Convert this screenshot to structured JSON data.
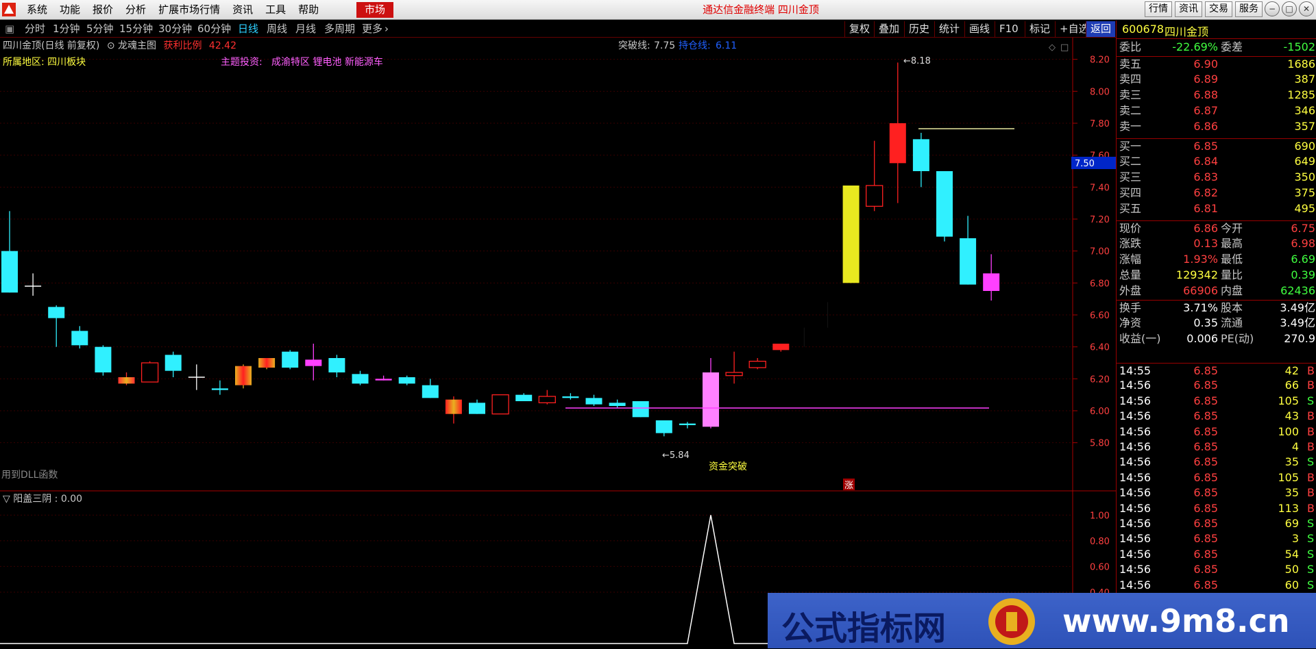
{
  "menu": [
    "系统",
    "功能",
    "报价",
    "分析",
    "扩展市场行情",
    "资讯",
    "工具",
    "帮助"
  ],
  "market_btn": "市场",
  "app_title": "通达信金融终端  四川金顶",
  "win_buttons": [
    "行情",
    "资讯",
    "交易",
    "服务"
  ],
  "timeframes": [
    "分时",
    "1分钟",
    "5分钟",
    "15分钟",
    "30分钟",
    "60分钟",
    "日线",
    "周线",
    "月线",
    "多周期",
    "更多"
  ],
  "active_timeframe": "日线",
  "right_tools": [
    "复权",
    "叠加",
    "历史",
    "统计",
    "画线",
    "F10",
    "标记",
    "+自选",
    "返回"
  ],
  "info": {
    "stock": "四川金顶(日线 前复权)",
    "indicator_name": "龙魂主图",
    "profit_label": "获利比例",
    "profit_value": "42.42",
    "breakout_label": "突破线:",
    "breakout_value": "7.75",
    "hold_label": "持仓线:",
    "hold_value": "6.11",
    "region_label": "所属地区:",
    "region_value": "四川板块",
    "theme_label": "主题投资:",
    "theme_value": "成渝特区 锂电池 新能源车",
    "dll_note": "用到DLL函数",
    "fund_break": "资金突破",
    "high_label": "8.18",
    "low_label": "5.84",
    "zhang": "涨"
  },
  "sub_indicator": {
    "name": "阳盖三阴",
    "value": "0.00"
  },
  "price_axis": [
    "8.20",
    "8.00",
    "7.80",
    "7.60",
    "7.40",
    "7.20",
    "7.00",
    "6.80",
    "6.60",
    "6.40",
    "6.20",
    "6.00",
    "5.80"
  ],
  "cursor_price": "7.50",
  "sub_axis": [
    "1.00",
    "0.80",
    "0.60",
    "0.40"
  ],
  "chart_data": {
    "type": "candlestick",
    "ylim": [
      5.7,
      8.25
    ],
    "ohlc": [
      [
        7.0,
        7.25,
        6.74,
        6.74,
        "cyan"
      ],
      [
        6.78,
        6.86,
        6.72,
        6.78,
        "cross"
      ],
      [
        6.65,
        6.66,
        6.4,
        6.58,
        "cyan"
      ],
      [
        6.5,
        6.53,
        6.39,
        6.41,
        "cyan"
      ],
      [
        6.4,
        6.41,
        6.22,
        6.24,
        "cyan"
      ],
      [
        6.17,
        6.24,
        6.16,
        6.21,
        "gold"
      ],
      [
        6.18,
        6.31,
        6.18,
        6.3,
        "hollow"
      ],
      [
        6.35,
        6.37,
        6.21,
        6.25,
        "cyan"
      ],
      [
        6.21,
        6.29,
        6.13,
        6.21,
        "cross"
      ],
      [
        6.14,
        6.19,
        6.1,
        6.13,
        "cyan"
      ],
      [
        6.16,
        6.29,
        6.14,
        6.28,
        "red-gold"
      ],
      [
        6.27,
        6.33,
        6.26,
        6.33,
        "red-gold"
      ],
      [
        6.37,
        6.38,
        6.26,
        6.27,
        "cyan"
      ],
      [
        6.28,
        6.42,
        6.19,
        6.32,
        "magenta"
      ],
      [
        6.33,
        6.35,
        6.21,
        6.24,
        "cyan"
      ],
      [
        6.23,
        6.25,
        6.16,
        6.17,
        "cyan"
      ],
      [
        6.2,
        6.22,
        6.19,
        6.19,
        "magenta"
      ],
      [
        6.21,
        6.22,
        6.16,
        6.17,
        "cyan"
      ],
      [
        6.16,
        6.2,
        6.08,
        6.08,
        "cyan"
      ],
      [
        5.98,
        6.09,
        5.92,
        6.07,
        "gold-red"
      ],
      [
        6.05,
        6.07,
        5.98,
        5.98,
        "cyan"
      ],
      [
        5.98,
        6.1,
        5.98,
        6.1,
        "hollow"
      ],
      [
        6.1,
        6.11,
        6.07,
        6.06,
        "cyan"
      ],
      [
        6.05,
        6.13,
        6.04,
        6.09,
        "hollow"
      ],
      [
        6.09,
        6.11,
        6.07,
        6.08,
        "cyan"
      ],
      [
        6.08,
        6.1,
        6.03,
        6.04,
        "cyan"
      ],
      [
        6.05,
        6.07,
        6.02,
        6.03,
        "cyan"
      ],
      [
        6.06,
        6.06,
        5.96,
        5.96,
        "cyan"
      ],
      [
        5.94,
        5.94,
        5.84,
        5.86,
        "cyan"
      ],
      [
        5.92,
        5.93,
        5.89,
        5.91,
        "cyan"
      ],
      [
        5.9,
        6.33,
        5.89,
        6.24,
        "pink"
      ],
      [
        6.22,
        6.37,
        6.17,
        6.24,
        "hollow"
      ],
      [
        6.27,
        6.33,
        6.26,
        6.31,
        "hollow"
      ],
      [
        6.38,
        6.42,
        6.37,
        6.42,
        "red"
      ],
      [
        6.42,
        6.52,
        6.4,
        6.52,
        "black"
      ],
      [
        6.55,
        6.68,
        6.52,
        6.65,
        "black"
      ],
      [
        6.8,
        7.41,
        6.8,
        7.41,
        "yellow"
      ],
      [
        7.28,
        7.69,
        7.25,
        7.41,
        "hollow"
      ],
      [
        7.55,
        8.18,
        7.3,
        7.8,
        "red"
      ],
      [
        7.7,
        7.74,
        7.4,
        7.5,
        "cyan"
      ],
      [
        7.5,
        7.5,
        7.06,
        7.09,
        "cyan"
      ],
      [
        7.08,
        7.22,
        6.79,
        6.79,
        "cyan"
      ],
      [
        6.86,
        6.98,
        6.69,
        6.75,
        "magenta"
      ]
    ],
    "sub_series": [
      0,
      0,
      0,
      0,
      0,
      0,
      0,
      0,
      0,
      0,
      0,
      0,
      0,
      0,
      0,
      0,
      0,
      0,
      0,
      0,
      0,
      0,
      0,
      0,
      0,
      0,
      0,
      0,
      0,
      0,
      1,
      0,
      0,
      0,
      0,
      0,
      0,
      0,
      0,
      0,
      0,
      0,
      0
    ]
  },
  "quote": {
    "code": "600678",
    "name": "四川金顶",
    "wb_label": "委比",
    "wb": "-22.69%",
    "wc_label": "委差",
    "wc": "-1502",
    "asks": [
      [
        "卖五",
        "6.90",
        "1686"
      ],
      [
        "卖四",
        "6.89",
        "387"
      ],
      [
        "卖三",
        "6.88",
        "1285"
      ],
      [
        "卖二",
        "6.87",
        "346"
      ],
      [
        "卖一",
        "6.86",
        "357"
      ]
    ],
    "bids": [
      [
        "买一",
        "6.85",
        "690"
      ],
      [
        "买二",
        "6.84",
        "649"
      ],
      [
        "买三",
        "6.83",
        "350"
      ],
      [
        "买四",
        "6.82",
        "375"
      ],
      [
        "买五",
        "6.81",
        "495"
      ]
    ],
    "stats": [
      [
        "现价",
        "6.86",
        "今开",
        "6.75"
      ],
      [
        "涨跌",
        "0.13",
        "最高",
        "6.98"
      ],
      [
        "涨幅",
        "1.93%",
        "最低",
        "6.69"
      ],
      [
        "总量",
        "129342",
        "量比",
        "0.39"
      ],
      [
        "外盘",
        "66906",
        "内盘",
        "62436"
      ]
    ],
    "fin": [
      [
        "换手",
        "3.71%",
        "股本",
        "3.49亿"
      ],
      [
        "净资",
        "0.35",
        "流通",
        "3.49亿"
      ],
      [
        "收益(一)",
        "0.006",
        "PE(动)",
        "270.9"
      ]
    ],
    "ticks": [
      [
        "14:55",
        "6.85",
        "42",
        "B"
      ],
      [
        "14:56",
        "6.85",
        "66",
        "B"
      ],
      [
        "14:56",
        "6.85",
        "105",
        "S"
      ],
      [
        "14:56",
        "6.85",
        "43",
        "B"
      ],
      [
        "14:56",
        "6.85",
        "100",
        "B"
      ],
      [
        "14:56",
        "6.85",
        "4",
        "B"
      ],
      [
        "14:56",
        "6.85",
        "35",
        "S"
      ],
      [
        "14:56",
        "6.85",
        "105",
        "B"
      ],
      [
        "14:56",
        "6.85",
        "35",
        "B"
      ],
      [
        "14:56",
        "6.85",
        "113",
        "B"
      ],
      [
        "14:56",
        "6.85",
        "69",
        "S"
      ],
      [
        "14:56",
        "6.85",
        "3",
        "S"
      ],
      [
        "14:56",
        "6.85",
        "54",
        "S"
      ],
      [
        "14:56",
        "6.85",
        "50",
        "S"
      ],
      [
        "14:56",
        "6.85",
        "60",
        "S"
      ]
    ]
  },
  "watermark": {
    "text": "公式指标网",
    "url": "www.9m8.cn"
  }
}
